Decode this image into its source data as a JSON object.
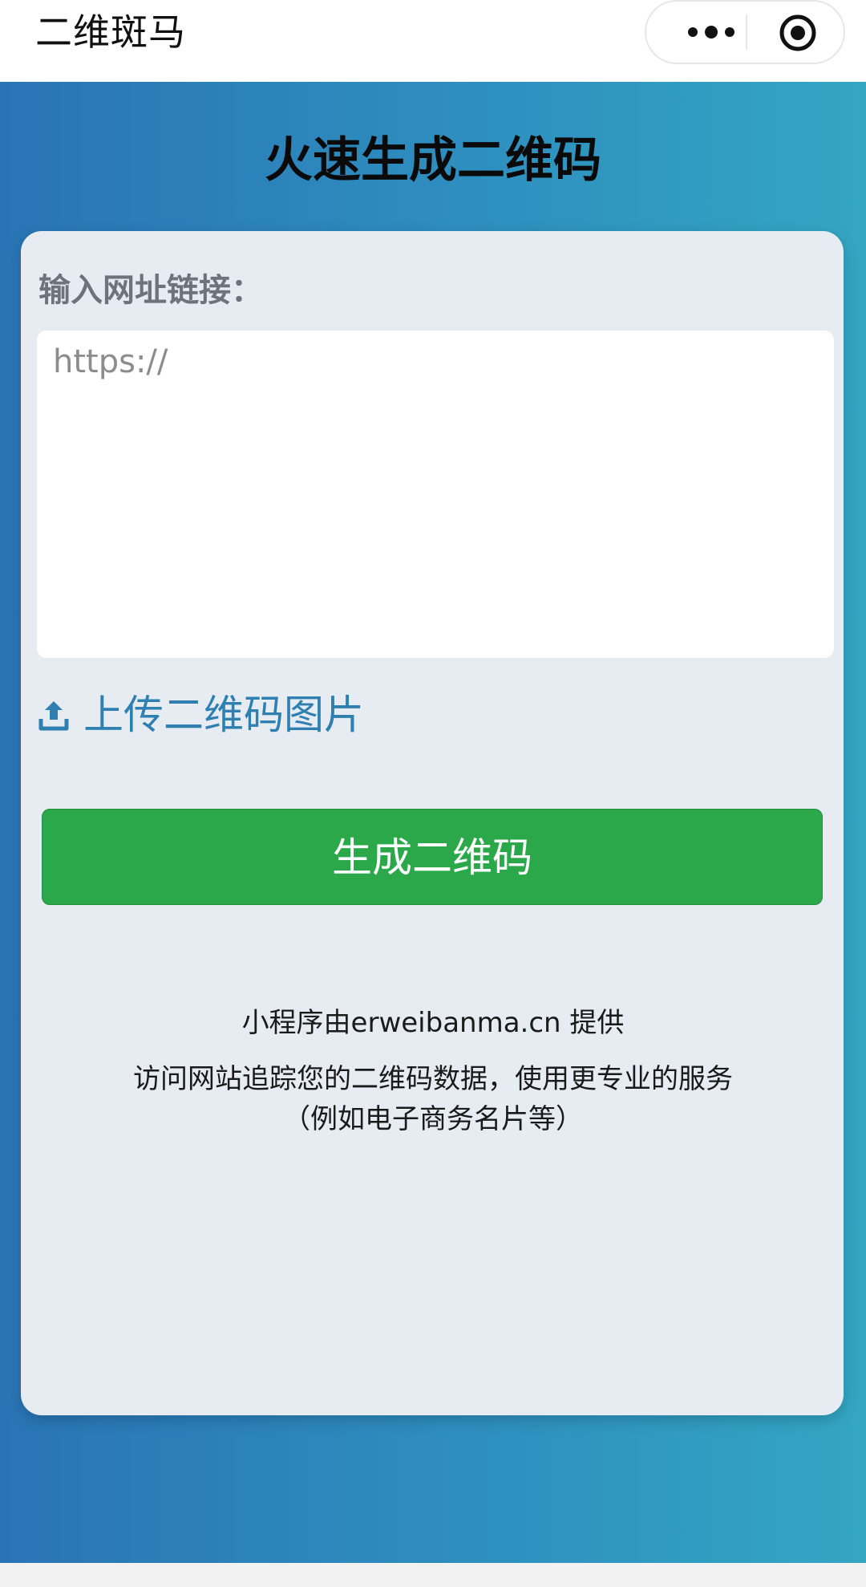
{
  "header": {
    "app_title": "二维斑马",
    "more_icon": "more-dots-icon",
    "close_icon": "target-circle-icon"
  },
  "main": {
    "title": "火速生成二维码",
    "input_label": "输入网址链接：",
    "url_input": {
      "placeholder": "https://",
      "value": ""
    },
    "upload": {
      "icon": "upload-icon",
      "label": "上传二维码图片"
    },
    "generate_button": "生成二维码",
    "footer": {
      "provider": "小程序由erweibanma.cn 提供",
      "info_line1": "访问网站追踪您的二维码数据，使用更专业的服务",
      "info_line2": "（例如电子商务名片等）"
    }
  },
  "colors": {
    "gradient_start": "#2a74b5",
    "gradient_end": "#33a6c2",
    "card_bg": "#e7ecf2",
    "button_green": "#2aa84a",
    "link_blue": "#2f7fb1"
  }
}
